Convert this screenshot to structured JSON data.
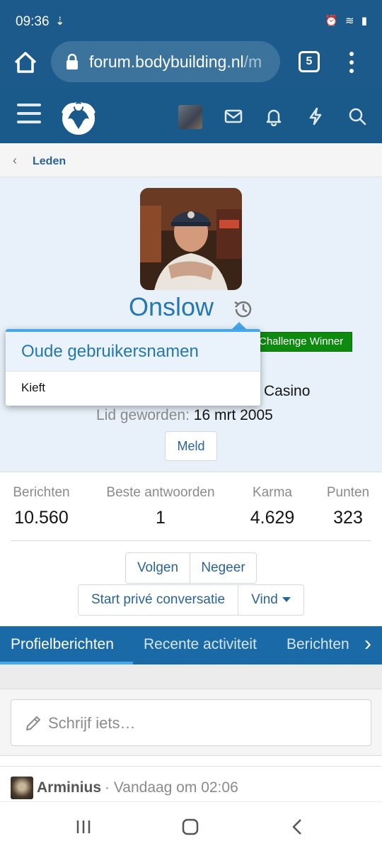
{
  "status_bar": {
    "time": "09:36"
  },
  "browser": {
    "url_host": "forum.bodybuilding.nl",
    "url_rest": "/m",
    "tab_count": "5"
  },
  "breadcrumb": {
    "label": "Leden"
  },
  "profile": {
    "username": "Onslow",
    "award": "Challenge Winner",
    "location": "Casino",
    "joined_label": "Lid geworden:",
    "joined_value": "16 mrt 2005",
    "report_label": "Meld"
  },
  "popup": {
    "title": "Oude gebruikersnamen",
    "items": [
      "Kieft"
    ]
  },
  "stats": [
    {
      "label": "Berichten",
      "value": "10.560"
    },
    {
      "label": "Beste antwoorden",
      "value": "1"
    },
    {
      "label": "Karma",
      "value": "4.629"
    },
    {
      "label": "Punten",
      "value": "323"
    }
  ],
  "actions": {
    "follow": "Volgen",
    "ignore": "Negeer",
    "start_conversation": "Start privé conversatie",
    "find": "Vind"
  },
  "tabs": [
    "Profielberichten",
    "Recente activiteit",
    "Berichten"
  ],
  "composer": {
    "placeholder": "Schrijf iets…"
  },
  "post": {
    "author": "Arminius",
    "time": "· Vandaag om 02:06"
  },
  "colors": {
    "header": "#1a5a8a",
    "accent": "#2577b1",
    "award": "#0e8a0e"
  }
}
